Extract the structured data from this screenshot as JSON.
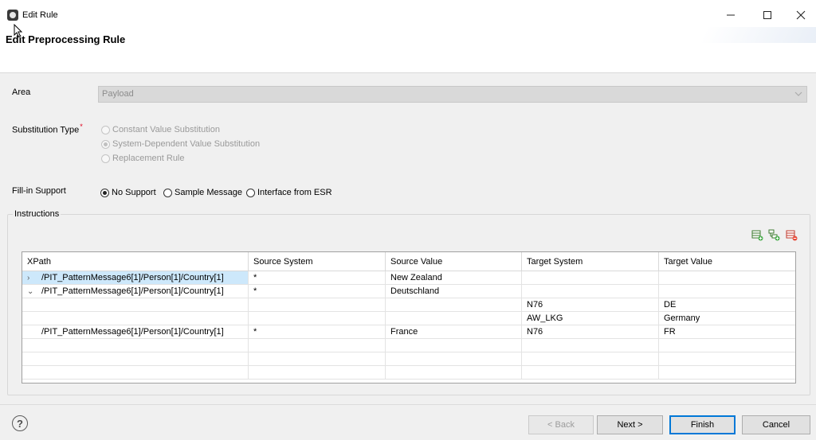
{
  "window": {
    "title": "Edit Rule",
    "minimize_icon": "minimize-icon",
    "maximize_icon": "maximize-icon",
    "close_icon": "close-icon"
  },
  "header": {
    "title": "Edit Preprocessing Rule"
  },
  "area": {
    "label": "Area",
    "value": "Payload"
  },
  "substitution": {
    "label": "Substitution Type",
    "required_marker": "*",
    "options": [
      {
        "label": "Constant Value Substitution",
        "checked": false,
        "disabled": true
      },
      {
        "label": "System-Dependent Value Substitution",
        "checked": true,
        "disabled": true
      },
      {
        "label": "Replacement Rule",
        "checked": false,
        "disabled": true
      }
    ]
  },
  "fillin": {
    "label": "Fill-in Support",
    "options": [
      {
        "label": "No Support",
        "checked": true
      },
      {
        "label": "Sample Message",
        "checked": false
      },
      {
        "label": "Interface from ESR",
        "checked": false
      }
    ]
  },
  "instructions": {
    "legend": "Instructions",
    "toolbar": [
      "add-row-icon",
      "add-child-row-icon",
      "delete-row-icon"
    ],
    "columns": [
      "XPath",
      "Source System",
      "Source Value",
      "Target System",
      "Target Value"
    ],
    "rows": [
      {
        "twist": "›",
        "xpath": "/PIT_PatternMessage6[1]/Person[1]/Country[1]",
        "source_system": "*",
        "source_value": "New Zealand",
        "target_system": "",
        "target_value": ""
      },
      {
        "twist": "⌄",
        "xpath": "/PIT_PatternMessage6[1]/Person[1]/Country[1]",
        "source_system": "*",
        "source_value": "Deutschland",
        "target_system": "",
        "target_value": ""
      },
      {
        "twist": "",
        "xpath": "",
        "source_system": "",
        "source_value": "",
        "target_system": "N76",
        "target_value": "DE"
      },
      {
        "twist": "",
        "xpath": "",
        "source_system": "",
        "source_value": "",
        "target_system": "AW_LKG",
        "target_value": "Germany"
      },
      {
        "twist": "",
        "xpath": "/PIT_PatternMessage6[1]/Person[1]/Country[1]",
        "source_system": "*",
        "source_value": "France",
        "target_system": "N76",
        "target_value": "FR"
      },
      {
        "twist": "",
        "xpath": "",
        "source_system": "",
        "source_value": "",
        "target_system": "",
        "target_value": ""
      },
      {
        "twist": "",
        "xpath": "",
        "source_system": "",
        "source_value": "",
        "target_system": "",
        "target_value": ""
      },
      {
        "twist": "",
        "xpath": "",
        "source_system": "",
        "source_value": "",
        "target_system": "",
        "target_value": ""
      }
    ]
  },
  "footer": {
    "help": "?",
    "back": "< Back",
    "next": "Next >",
    "finish": "Finish",
    "cancel": "Cancel"
  }
}
